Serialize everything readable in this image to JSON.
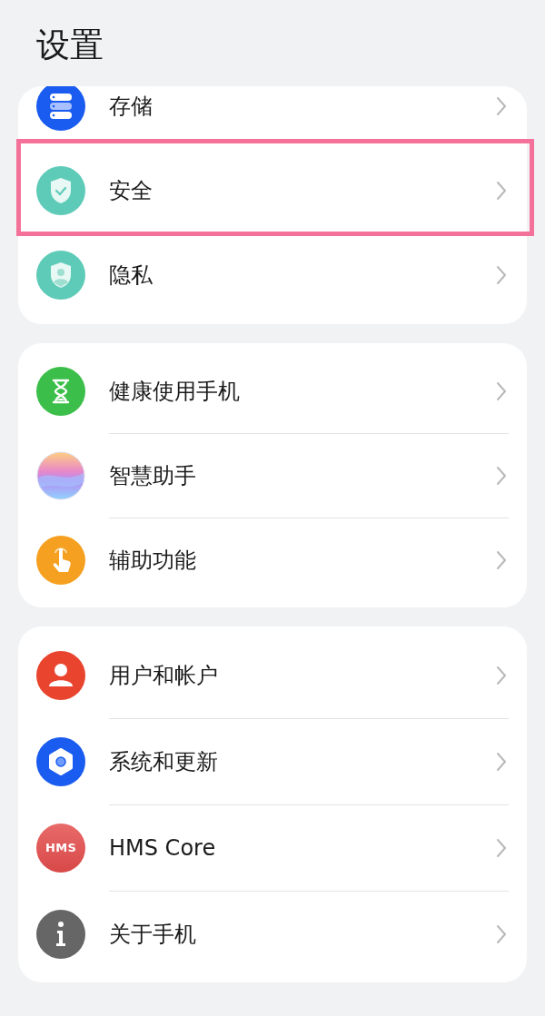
{
  "title": "设置",
  "groups": [
    {
      "items": [
        {
          "label": "存储",
          "kind": "storage",
          "highlighted": false
        },
        {
          "label": "安全",
          "kind": "security",
          "highlighted": true
        },
        {
          "label": "隐私",
          "kind": "privacy",
          "highlighted": false
        }
      ]
    },
    {
      "items": [
        {
          "label": "健康使用手机",
          "kind": "hourglass",
          "highlighted": false
        },
        {
          "label": "智慧助手",
          "kind": "assistant",
          "highlighted": false
        },
        {
          "label": "辅助功能",
          "kind": "accessibility",
          "highlighted": false
        }
      ]
    },
    {
      "items": [
        {
          "label": "用户和帐户",
          "kind": "user",
          "highlighted": false
        },
        {
          "label": "系统和更新",
          "kind": "settings",
          "highlighted": false
        },
        {
          "label": "HMS Core",
          "kind": "hms",
          "icon_text": "HMS",
          "highlighted": false
        },
        {
          "label": "关于手机",
          "kind": "info",
          "highlighted": false
        }
      ]
    }
  ]
}
